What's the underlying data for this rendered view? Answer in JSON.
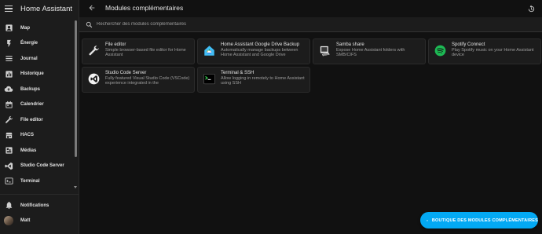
{
  "sidebar": {
    "title": "Home Assistant",
    "items": [
      {
        "label": "Map",
        "icon": "account-box-icon"
      },
      {
        "label": "Énergie",
        "icon": "lightning-icon"
      },
      {
        "label": "Journal",
        "icon": "format-list-icon"
      },
      {
        "label": "Historique",
        "icon": "chart-box-icon"
      },
      {
        "label": "Backups",
        "icon": "cloud-upload-icon"
      },
      {
        "label": "Calendrier",
        "icon": "calendar-icon"
      },
      {
        "label": "File editor",
        "icon": "wrench-icon"
      },
      {
        "label": "HACS",
        "icon": "hacs-icon"
      },
      {
        "label": "Médias",
        "icon": "play-box-icon"
      },
      {
        "label": "Studio Code Server",
        "icon": "vscode-icon"
      },
      {
        "label": "Terminal",
        "icon": "console-icon"
      }
    ],
    "bottom": {
      "notifications": "Notifications",
      "user": "Matt"
    }
  },
  "topbar": {
    "title": "Modules complémentaires"
  },
  "search": {
    "placeholder": "Rechercher des modules complémentaires"
  },
  "addons": [
    {
      "name": "File editor",
      "description": "Simple browser-based file editor for Home Assistant",
      "icon": "file-editor-logo"
    },
    {
      "name": "Home Assistant Google Drive Backup",
      "description": "Automatically manage backups between Home Assistant and Google Drive",
      "icon": "google-drive-logo"
    },
    {
      "name": "Samba share",
      "description": "Expose Home Assistant folders with SMB/CIFS",
      "icon": "samba-logo"
    },
    {
      "name": "Spotify Connect",
      "description": "Play Spotify music on your Home Assistant device",
      "icon": "spotify-logo"
    },
    {
      "name": "Studio Code Server",
      "description": "Fully featured Visual Studio Code (VSCode) experience integrated in the",
      "icon": "vscode-logo"
    },
    {
      "name": "Terminal & SSH",
      "description": "Allow logging in remotely to Home Assistant using SSH",
      "icon": "terminal-logo"
    }
  ],
  "fab": {
    "label": "BOUTIQUE DES MODULES COMPLÉMENTAIRES"
  },
  "colors": {
    "accent": "#03a9f4",
    "background": "#111111",
    "card": "#1c1c1c",
    "spotify": "#1db954"
  }
}
